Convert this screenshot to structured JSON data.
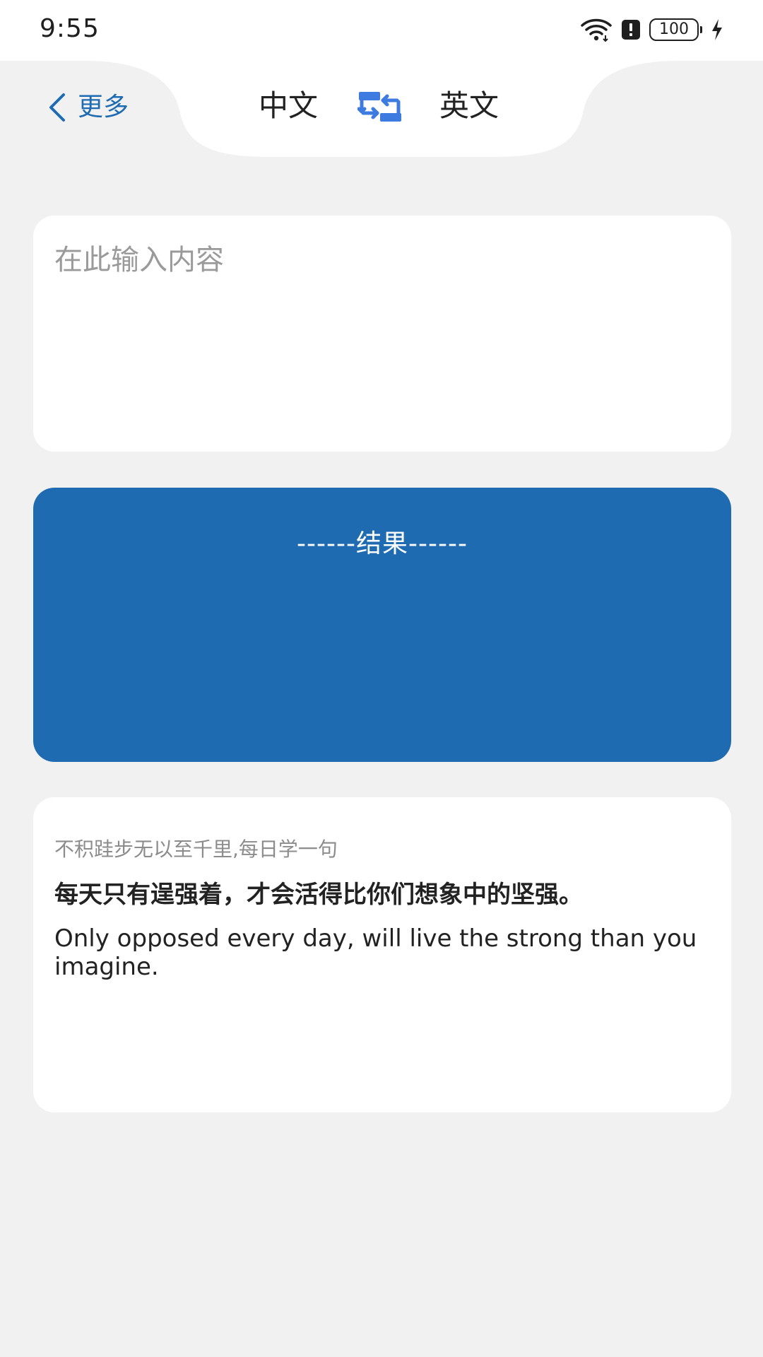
{
  "status_bar": {
    "time": "9:55",
    "battery_level": "100",
    "icons": [
      "wifi-icon",
      "alert-icon",
      "battery-icon",
      "charging-icon"
    ]
  },
  "header": {
    "back_label": "更多",
    "source_language": "中文",
    "target_language": "英文",
    "swap_icon": "swap-language-icon"
  },
  "input": {
    "placeholder": "在此输入内容",
    "value": ""
  },
  "result": {
    "label": "------结果------"
  },
  "daily": {
    "caption": "不积跬步无以至千里,每日学一句",
    "chinese": "每天只有逞强着，才会活得比你们想象中的坚强。",
    "english": "Only opposed every day, will live the strong than you imagine."
  },
  "colors": {
    "accent": "#1e6bb1",
    "background": "#f1f1f1",
    "card": "#ffffff"
  }
}
